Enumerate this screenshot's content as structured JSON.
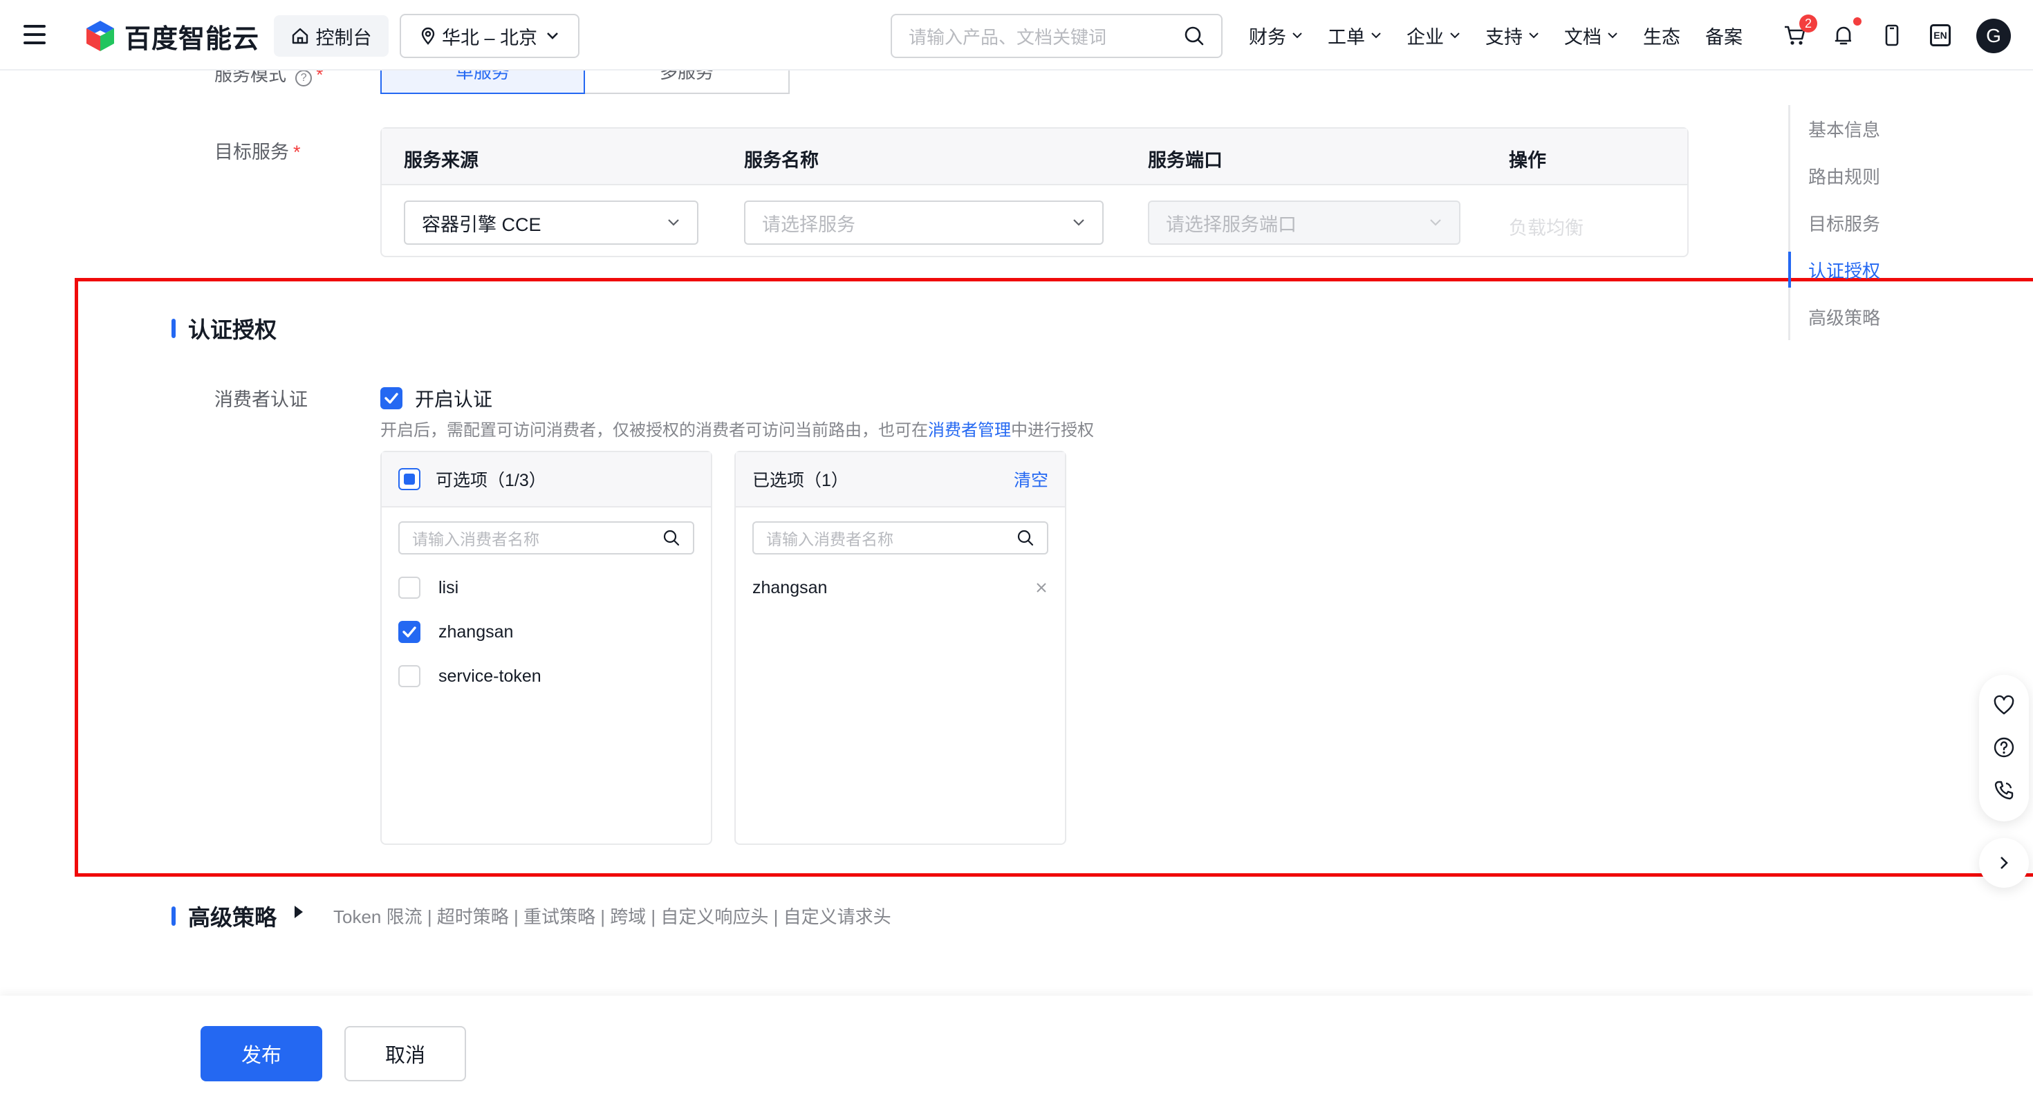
{
  "header": {
    "brand": "百度智能云",
    "console_label": "控制台",
    "region_label": "华北 – 北京",
    "search_placeholder": "请输入产品、文档关键词",
    "nav": [
      {
        "label": "财务",
        "has_dropdown": true
      },
      {
        "label": "工单",
        "has_dropdown": true
      },
      {
        "label": "企业",
        "has_dropdown": true
      },
      {
        "label": "支持",
        "has_dropdown": true
      },
      {
        "label": "文档",
        "has_dropdown": true
      },
      {
        "label": "生态",
        "has_dropdown": false
      },
      {
        "label": "备案",
        "has_dropdown": false
      }
    ],
    "cart_badge": "2",
    "lang_label": "EN",
    "avatar_letter": "G"
  },
  "service_mode": {
    "label": "服务模式",
    "options": [
      "单服务",
      "多服务"
    ],
    "selected": "单服务"
  },
  "target_service": {
    "label": "目标服务",
    "columns": [
      "服务来源",
      "服务名称",
      "服务端口",
      "操作"
    ],
    "source_value": "容器引擎 CCE",
    "name_placeholder": "请选择服务",
    "port_placeholder": "请选择服务端口",
    "action": "负载均衡"
  },
  "auth": {
    "title": "认证授权",
    "consumer_label": "消费者认证",
    "enable_label": "开启认证",
    "enabled": true,
    "help_before": "开启后，需配置可访问消费者，仅被授权的消费者可访问当前路由，也可在",
    "help_link": "消费者管理",
    "help_after": "中进行授权",
    "available_title": "可选项（1/3）",
    "selected_title": "已选项（1）",
    "clear_label": "清空",
    "search_placeholder": "请输入消费者名称",
    "available_items": [
      {
        "name": "lisi",
        "checked": false
      },
      {
        "name": "zhangsan",
        "checked": true
      },
      {
        "name": "service-token",
        "checked": false
      }
    ],
    "selected_items": [
      "zhangsan"
    ]
  },
  "advanced": {
    "title": "高级策略",
    "links": "Token 限流 | 超时策略 | 重试策略 | 跨域 | 自定义响应头 | 自定义请求头"
  },
  "anchors": {
    "items": [
      "基本信息",
      "路由规则",
      "目标服务",
      "认证授权",
      "高级策略"
    ],
    "active": "认证授权"
  },
  "footer": {
    "publish_label": "发布",
    "cancel_label": "取消"
  },
  "colors": {
    "primary": "#2468f2",
    "highlight_border": "#f00a0a",
    "required": "#f33e3e"
  },
  "icons": [
    "menu-icon",
    "home-icon",
    "location-icon",
    "search-icon",
    "cart-icon",
    "bell-icon",
    "mobile-icon",
    "heart-icon",
    "help-icon",
    "phone-icon",
    "chevron-right-icon",
    "close-icon"
  ]
}
